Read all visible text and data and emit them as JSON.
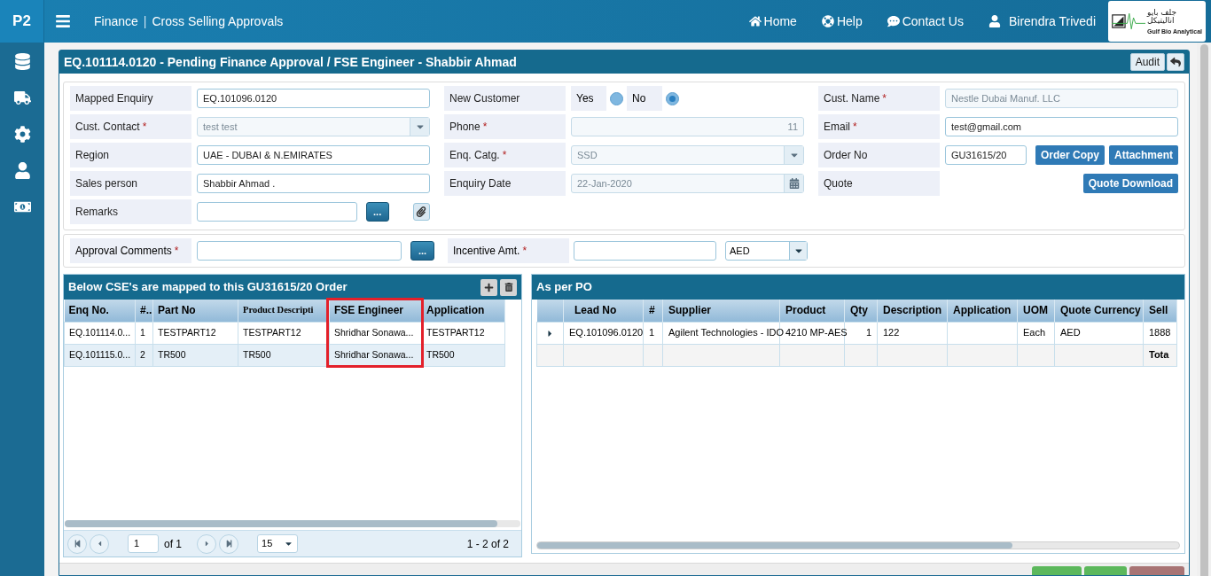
{
  "brand": "P2",
  "breadcrumb": {
    "module": "Finance",
    "separator": "|",
    "page": "Cross Selling Approvals"
  },
  "nav": [
    {
      "kind": "home",
      "label": "Home"
    },
    {
      "kind": "help",
      "label": "Help"
    },
    {
      "kind": "contact",
      "label": "Contact Us"
    },
    {
      "kind": "user",
      "label": "Birendra Trivedi"
    }
  ],
  "logo": {
    "arabic": "جلف بايو اناليتيكل",
    "english": "Gulf Bio Analytical"
  },
  "sidebar": [
    {
      "kind": "database"
    },
    {
      "kind": "truck"
    },
    {
      "kind": "settings"
    },
    {
      "kind": "user"
    },
    {
      "kind": "money"
    }
  ],
  "panel": {
    "title": "EQ.101114.0120 - Pending Finance Approval / FSE Engineer - Shabbir Ahmad",
    "audit": "Audit"
  },
  "form_columns": [
    [
      {
        "label": "Mapped Enquiry",
        "kind": "input",
        "value": "EQ.101096.0120",
        "disabled": false
      },
      {
        "label": "Cust. Contact",
        "required_mark": "*",
        "kind": "select",
        "value": "test test",
        "disabled": true
      },
      {
        "label": "Region",
        "kind": "input",
        "value": "UAE - DUBAI & N.EMIRATES",
        "disabled": false
      },
      {
        "label": "Sales person",
        "kind": "input",
        "value": "Shabbir Ahmad .",
        "disabled": false
      },
      {
        "label": "Remarks",
        "kind": "remarks",
        "button": "...",
        "disabled": false
      }
    ],
    [
      {
        "label": "New Customer",
        "kind": "radio",
        "options": [
          {
            "label": "Yes",
            "selected": false
          },
          {
            "label": "No",
            "selected": true
          }
        ]
      },
      {
        "label": "Phone",
        "required_mark": "*",
        "kind": "input",
        "value": "11",
        "right_aligned": true,
        "disabled": true
      },
      {
        "label": "Enq. Catg.",
        "required_mark": "*",
        "kind": "select",
        "value": "SSD",
        "disabled": true
      },
      {
        "label": "Enquiry Date",
        "kind": "date",
        "value": "22-Jan-2020",
        "disabled": true
      }
    ],
    [
      {
        "label": "Cust. Name",
        "required_mark": "*",
        "kind": "input",
        "value": "Nestle Dubai Manuf. LLC",
        "disabled": true
      },
      {
        "label": "Email",
        "required_mark": "*",
        "kind": "input",
        "value": "test@gmail.com",
        "disabled": false
      },
      {
        "label": "Order No",
        "kind": "order",
        "value": "GU31615/20",
        "buttons": [
          "Order Copy",
          "Attachment"
        ],
        "disabled": false
      },
      {
        "label": "Quote",
        "kind": "quote",
        "buttons": [
          "Quote Download"
        ]
      }
    ]
  ],
  "approval": {
    "comments_label": "Approval Comments",
    "comments_mark": "*",
    "button": "...",
    "incentive_label": "Incentive Amt.",
    "incentive_mark": "*",
    "currency": "AED"
  },
  "left_grid": {
    "title": "Below CSE's are mapped to this GU31615/20 Order",
    "columns": [
      {
        "label": "Enq No.",
        "highlighted": false
      },
      {
        "label": "#..",
        "highlighted": false
      },
      {
        "label": "Part No",
        "highlighted": false
      },
      {
        "label": "Product Descripti",
        "highlighted": false
      },
      {
        "label": "FSE Engineer",
        "highlighted": true
      },
      {
        "label": "Application",
        "highlighted": false
      }
    ],
    "rows": [
      {
        "selected": false,
        "cells": [
          "EQ.101114.0...",
          "1",
          "TESTPART12",
          "TESTPART12",
          "Shridhar Sonawa...",
          "TESTPART12"
        ]
      },
      {
        "selected": true,
        "cells": [
          "EQ.101115.0...",
          "2",
          "TR500",
          "TR500",
          "Shridhar Sonawa...",
          "TR500"
        ]
      }
    ],
    "pager": {
      "page": "1",
      "of": "of 1",
      "size": "15",
      "summary": "1 - 2 of 2"
    }
  },
  "right_grid": {
    "title": "As per PO",
    "columns": [
      "Lead No",
      "#",
      "Supplier",
      "Product",
      "Qty",
      "Description",
      "Application",
      "UOM",
      "Quote Currency",
      "Sell"
    ],
    "rows": [
      {
        "current": true,
        "kind": "data",
        "cells": [
          "EQ.101096.0120",
          "1",
          "Agilent Technologies - IDO",
          "4210 MP-AES",
          "1",
          "122",
          "",
          "Each",
          "AED",
          "1888"
        ]
      },
      {
        "current": false,
        "kind": "total",
        "cells": [
          "",
          "",
          "",
          "",
          "",
          "",
          "",
          "",
          "",
          "Tota"
        ]
      }
    ]
  },
  "footer_buttons": [
    {
      "kind": "approve"
    },
    {
      "kind": "reject"
    },
    {
      "kind": "cancel"
    }
  ]
}
